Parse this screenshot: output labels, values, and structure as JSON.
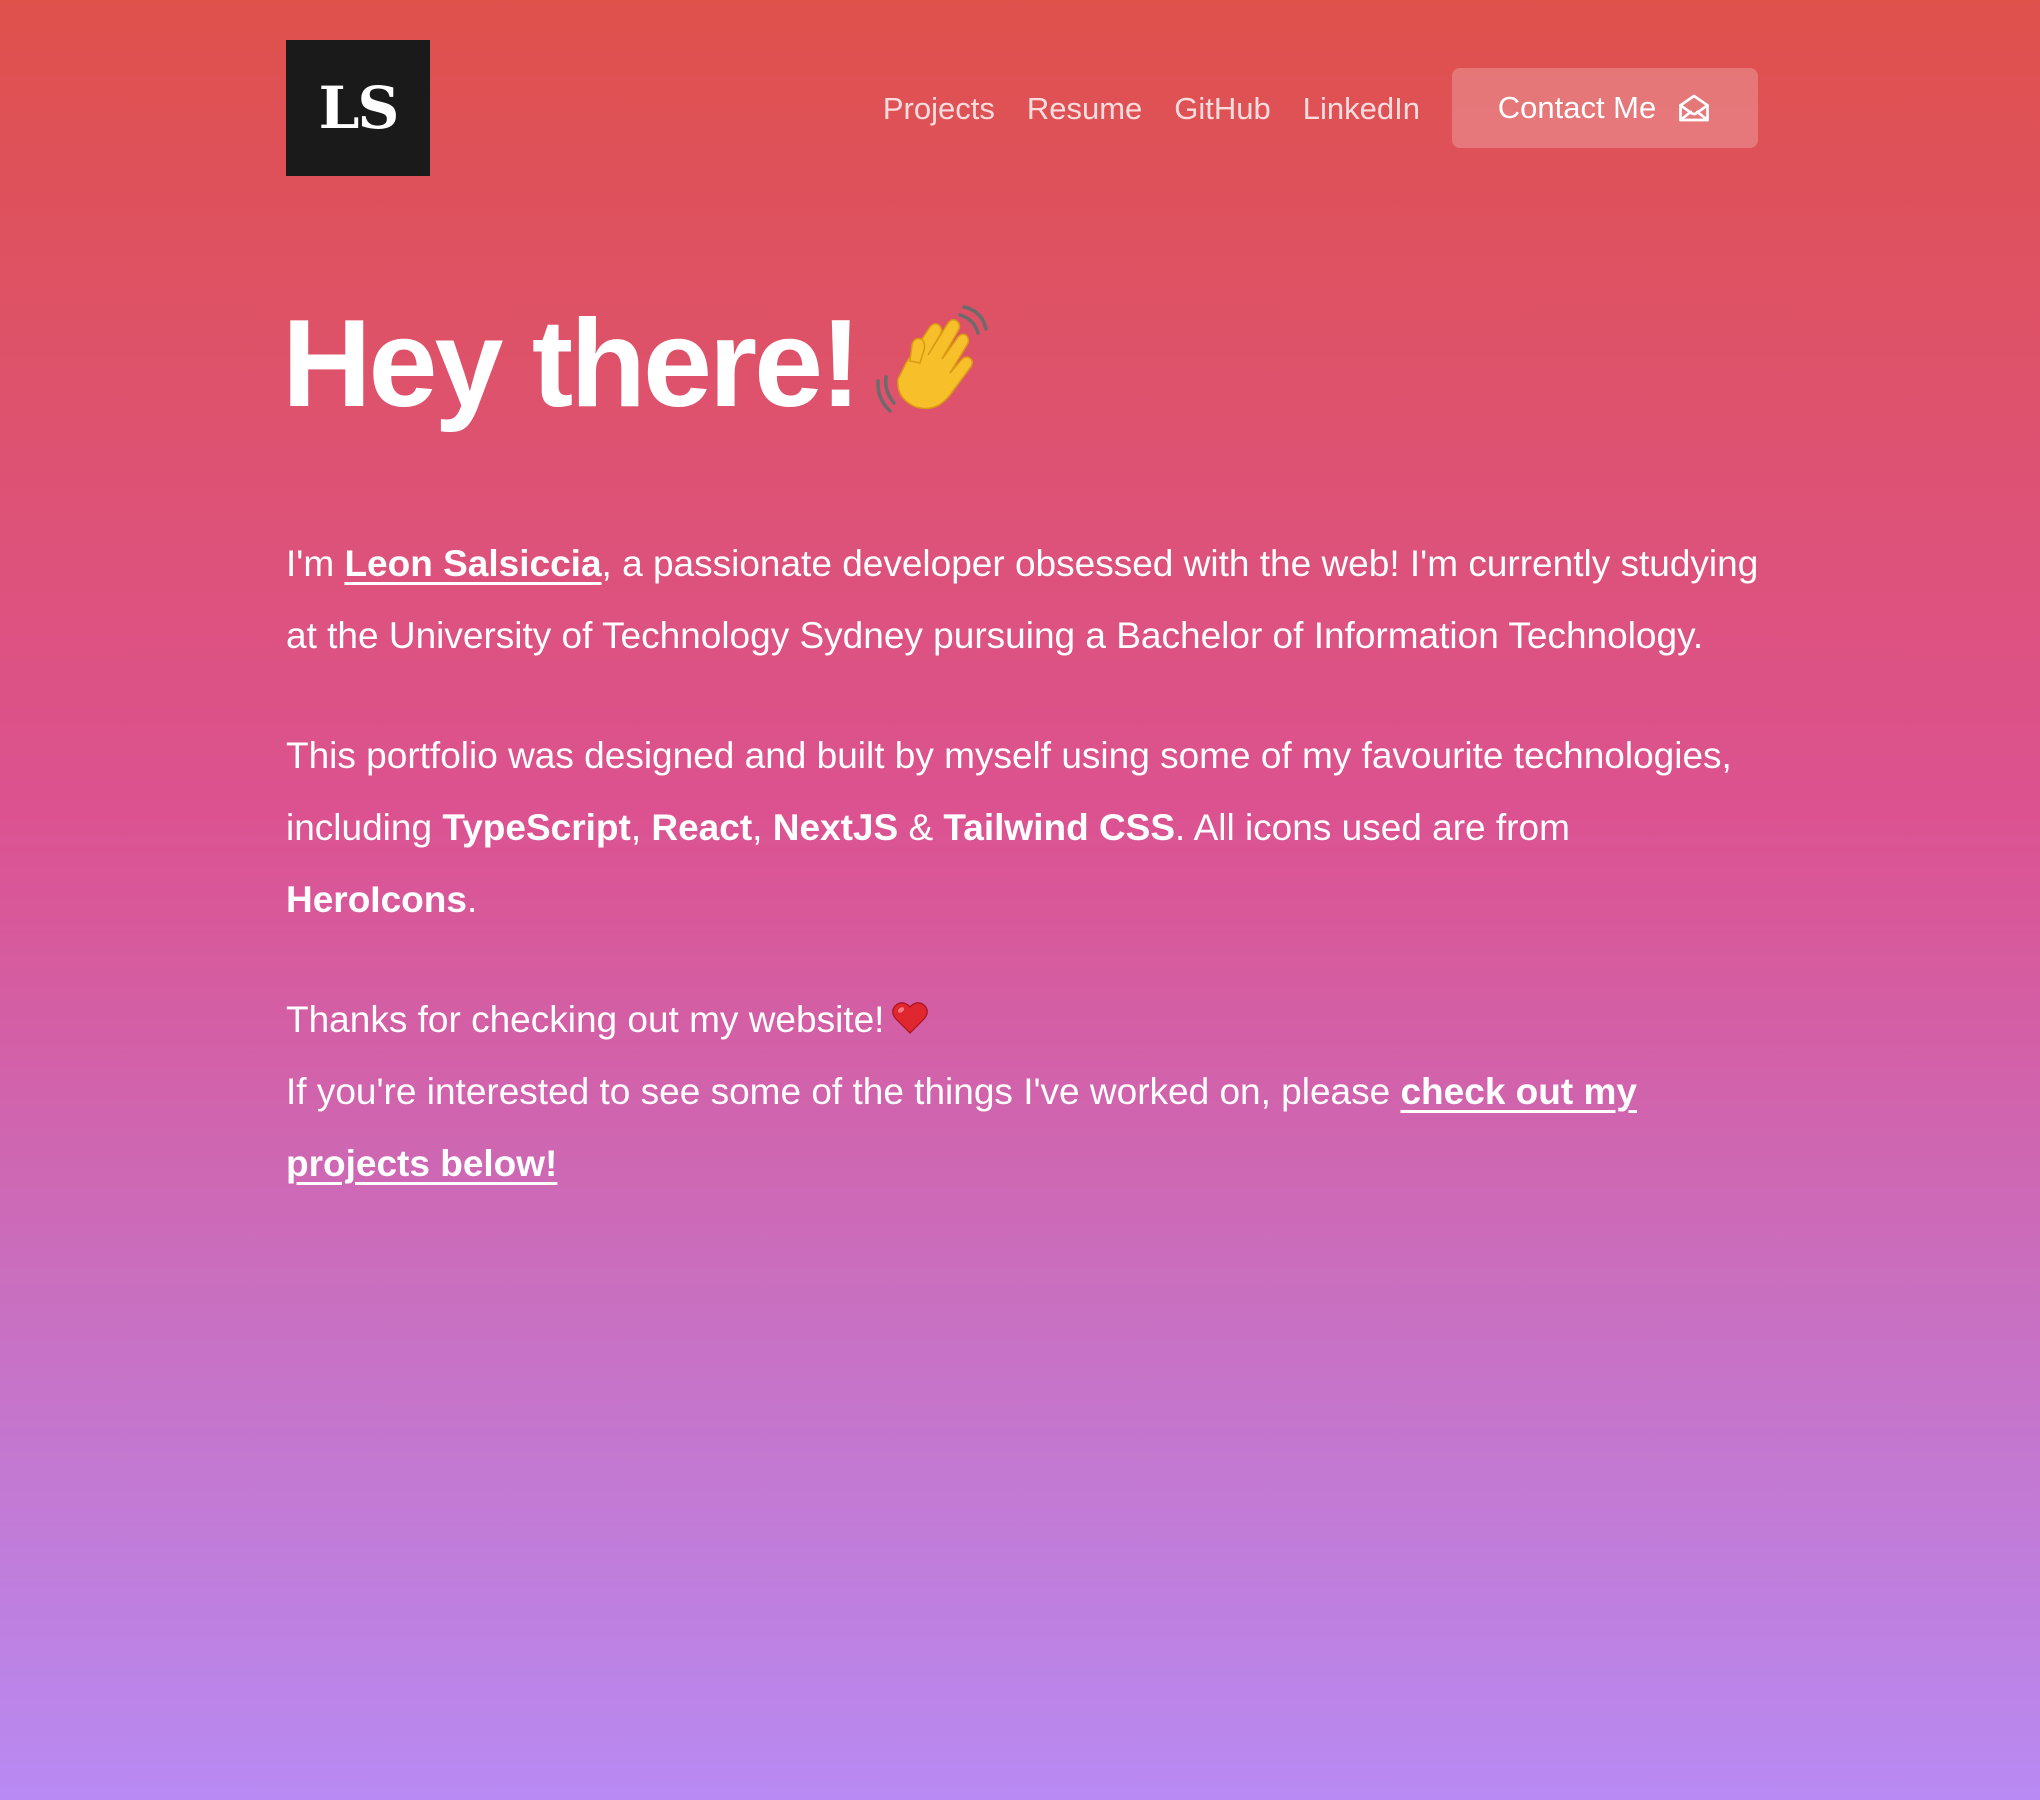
{
  "header": {
    "logo_text": "LS",
    "nav": [
      {
        "label": "Projects"
      },
      {
        "label": "Resume"
      },
      {
        "label": "GitHub"
      },
      {
        "label": "LinkedIn"
      }
    ],
    "contact_label": "Contact Me",
    "contact_icon": "envelope-open-icon"
  },
  "hero": {
    "title": "Hey there!",
    "title_icon": "waving-hand-icon"
  },
  "bio": {
    "p1": {
      "prefix": "I'm ",
      "name": "Leon Salsiccia",
      "suffix": ", a passionate developer obsessed with the web! I'm currently studying at the University of Technology Sydney pursuing a Bachelor of Information Technology."
    },
    "p2": {
      "prefix": "This portfolio was designed and built by myself using some of my favourite technologies, including ",
      "tech1": "TypeScript",
      "sep1": ", ",
      "tech2": "React",
      "sep2": ", ",
      "tech3": "NextJS",
      "sep3": " & ",
      "tech4": "Tailwind CSS",
      "mid": ". All icons used are from ",
      "icons": "HeroIcons",
      "end": "."
    },
    "p3": {
      "line1": "Thanks for checking out my website!",
      "line1_icon": "heart-icon",
      "line2_prefix": "If you're interested to see some of the things I've worked on, please ",
      "link": "check out my projects below!"
    }
  },
  "colors": {
    "gradient_top": "#df514b",
    "gradient_mid": "#dc5290",
    "gradient_bottom": "#b88af3",
    "logo_bg": "#1a1a1a",
    "text": "#ffffff"
  }
}
